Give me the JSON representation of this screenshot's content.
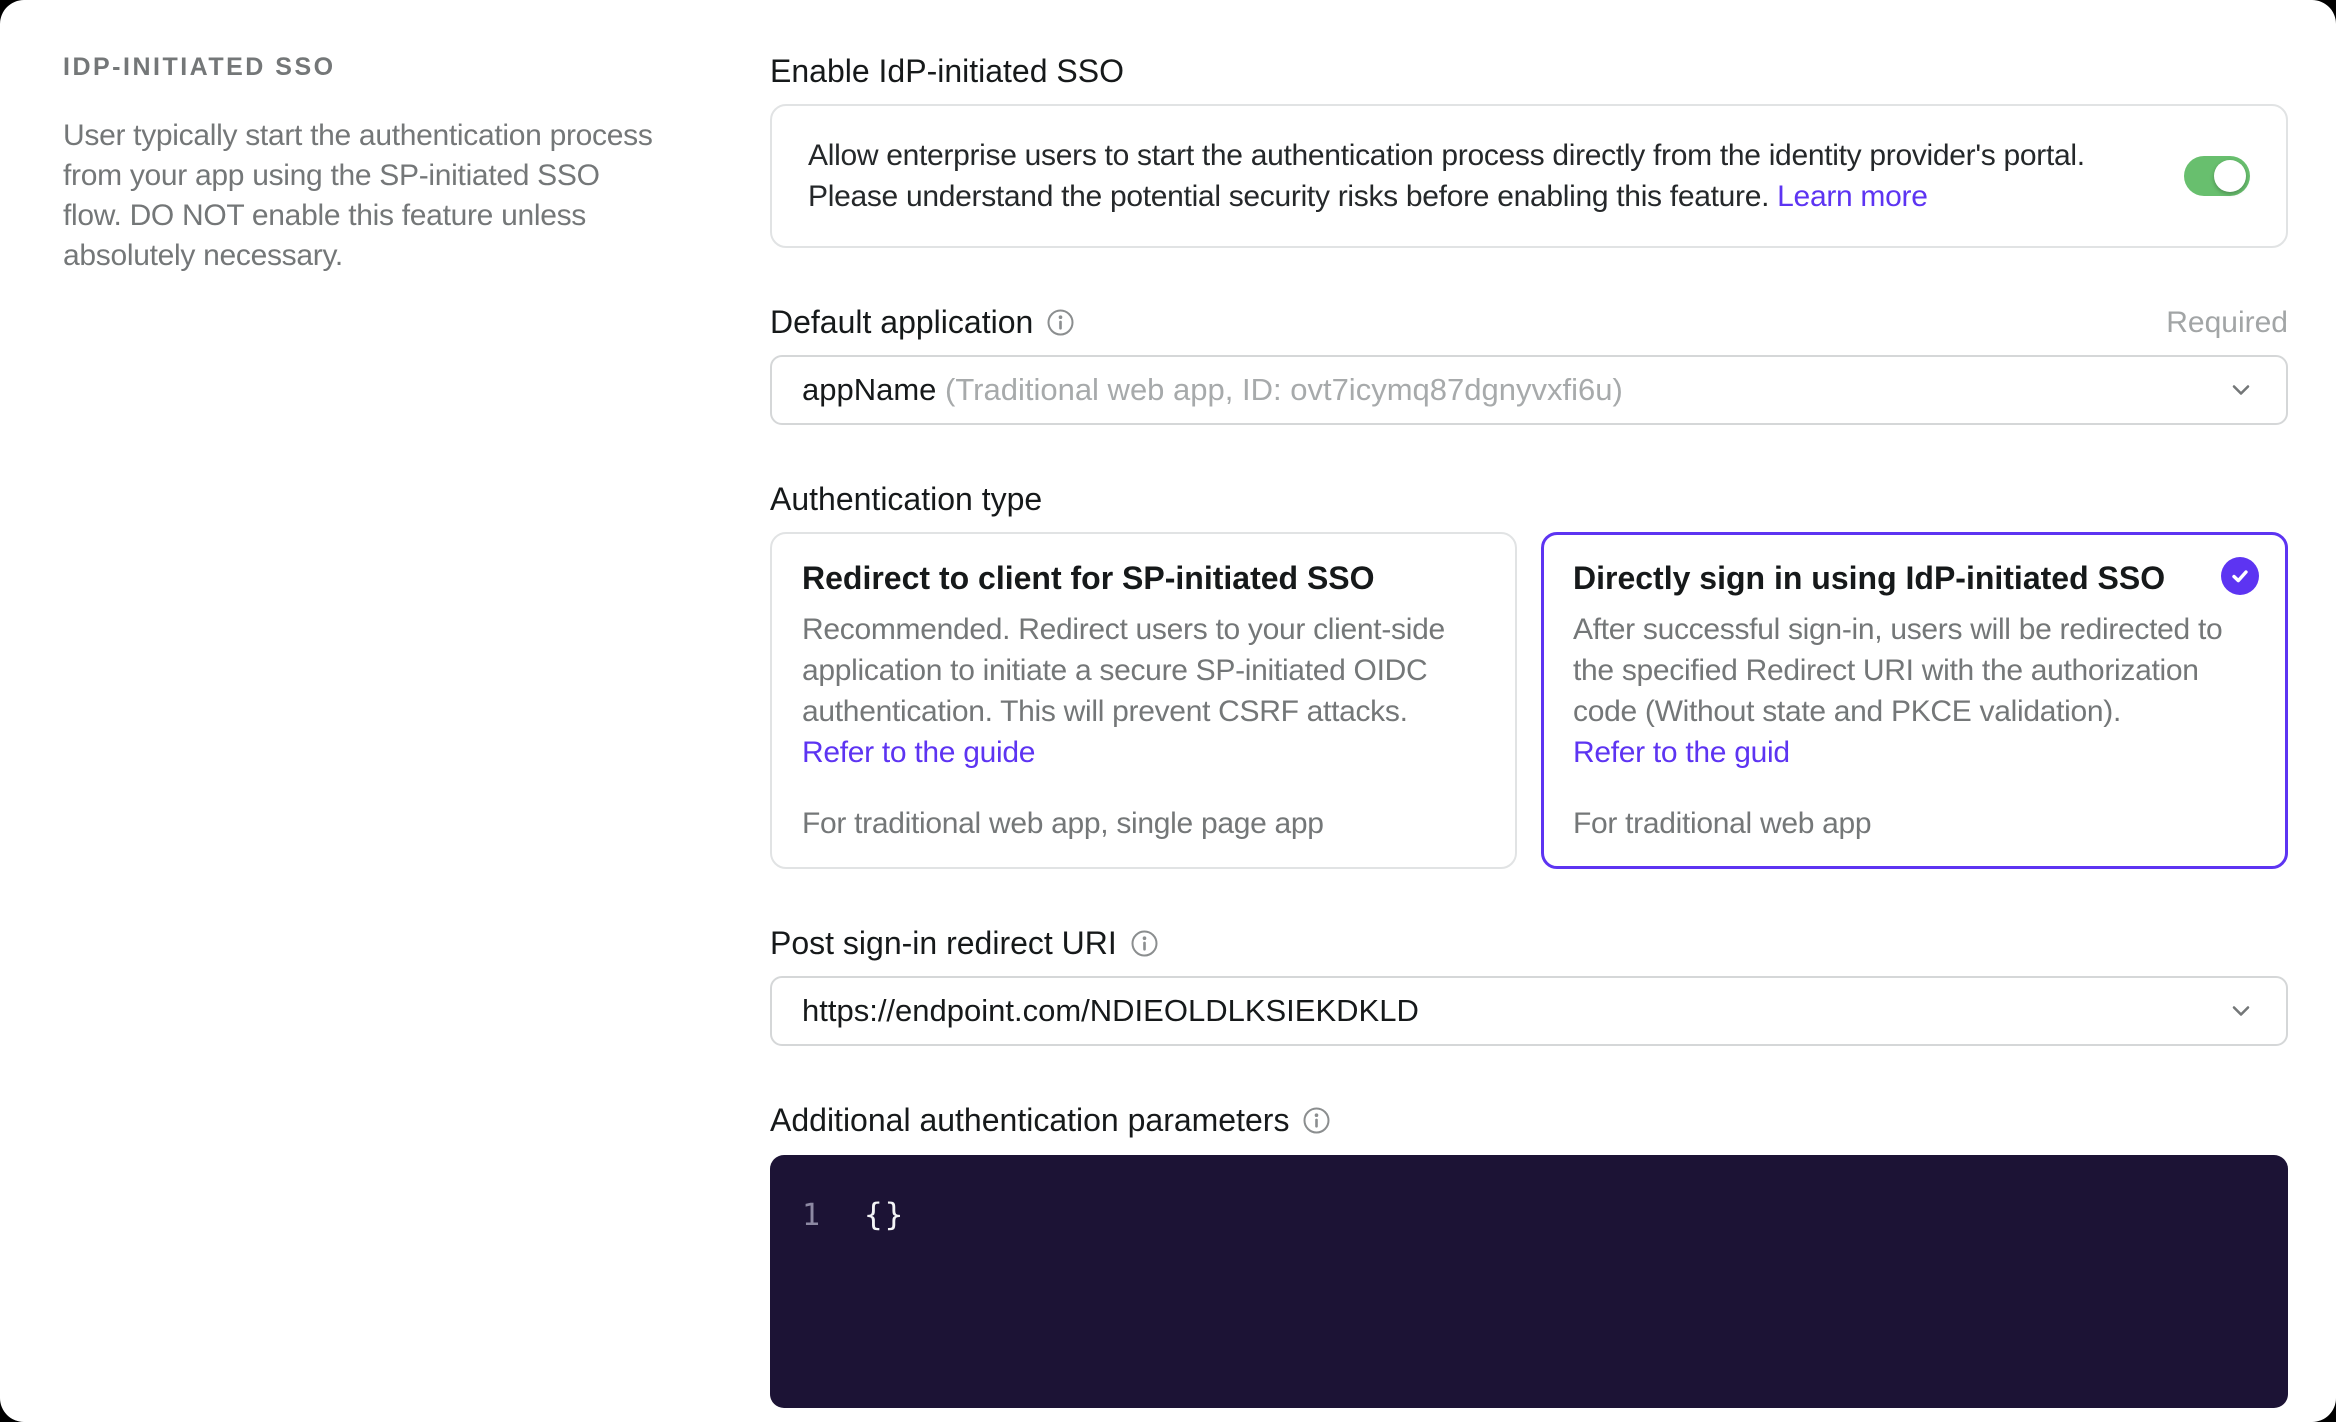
{
  "sidebar": {
    "heading": "IDP-INITIATED SSO",
    "description": "User typically start the authentication process from your app using the SP-initiated SSO flow. DO NOT enable this feature unless absolutely necessary."
  },
  "enable_section": {
    "label": "Enable IdP-initiated SSO",
    "description": "Allow enterprise users to start the authentication process directly from the identity provider's portal. Please understand the potential security risks before enabling this feature. ",
    "link_label": "Learn more",
    "toggle_state": "on"
  },
  "default_application": {
    "label": "Default application",
    "required_label": "Required",
    "value_primary": "appName ",
    "value_secondary": "(Traditional web app, ID: ovt7icymq87dgnyvxfi6u)"
  },
  "authentication_type": {
    "label": "Authentication type",
    "options": [
      {
        "title": "Redirect to client for SP-initiated SSO",
        "description": "Recommended. Redirect users to your client-side application to initiate a secure SP-initiated OIDC authentication. This will prevent CSRF attacks. ",
        "link_label": "Refer to the guide",
        "footnote": "For traditional web app, single page app",
        "selected": false
      },
      {
        "title": "Directly sign in using IdP-initiated SSO",
        "description": "After successful sign-in, users will be redirected to the specified Redirect URI with the authorization code (Without state and PKCE validation). ",
        "link_label": "Refer to the guid",
        "footnote": "For traditional web app",
        "selected": true
      }
    ]
  },
  "redirect_uri": {
    "label": "Post sign-in redirect URI",
    "value": "https://endpoint.com/NDIEOLDLKSIEKDKLD"
  },
  "additional_params": {
    "label": "Additional authentication parameters",
    "editor": {
      "line_number": "1",
      "code": "{}"
    }
  },
  "colors": {
    "accent_purple": "#5d34f2",
    "toggle_green": "#68bf6e",
    "editor_background": "#1c1335",
    "page_background": "#000000",
    "surface": "#ffffff"
  }
}
